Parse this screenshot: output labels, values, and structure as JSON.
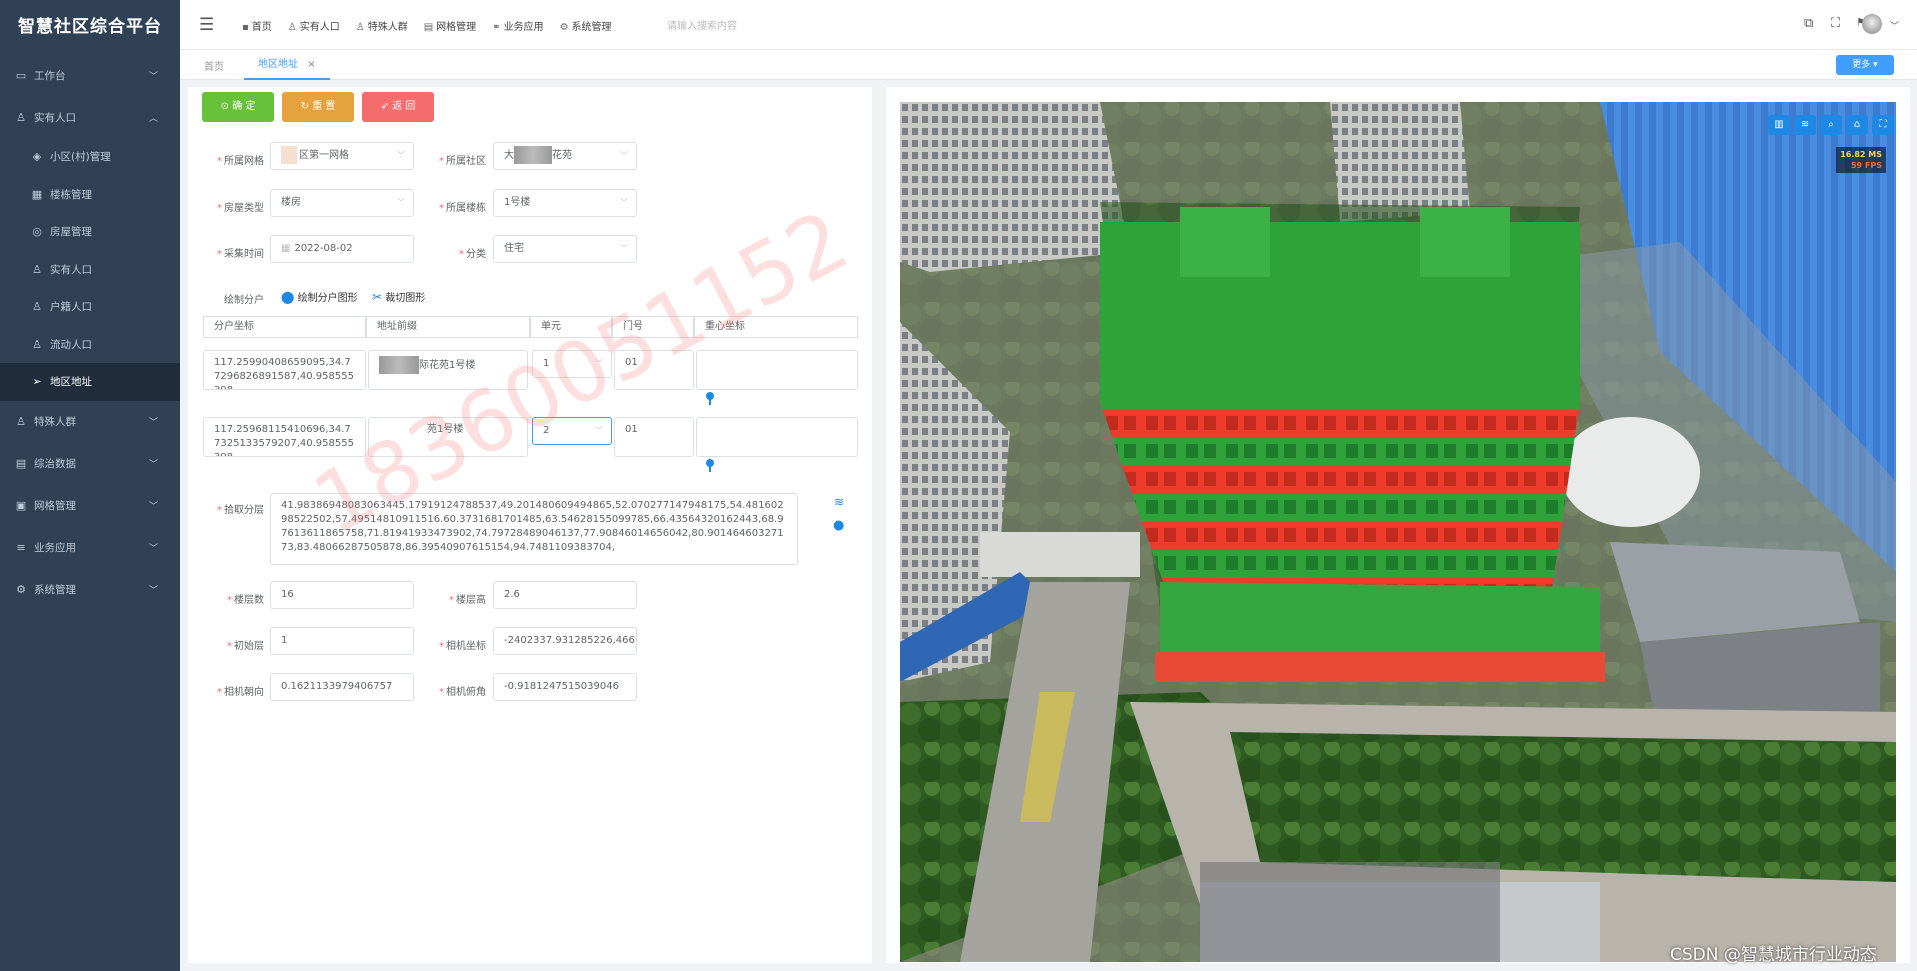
{
  "app": {
    "title": "智慧社区综合平台"
  },
  "sidebar": {
    "menus": [
      {
        "label": "工作台",
        "icon": "monitor-icon",
        "expanded": false
      },
      {
        "label": "实有人口",
        "icon": "user-icon",
        "expanded": true
      }
    ],
    "subitems": [
      {
        "label": "小区(村)管理",
        "icon": "tag-icon"
      },
      {
        "label": "楼栋管理",
        "icon": "building-icon"
      },
      {
        "label": "房屋管理",
        "icon": "location-icon"
      },
      {
        "label": "实有人口",
        "icon": "user-icon"
      },
      {
        "label": "户籍人口",
        "icon": "user-icon"
      },
      {
        "label": "流动人口",
        "icon": "user-icon"
      },
      {
        "label": "地区地址",
        "icon": "send-icon",
        "active": true
      }
    ],
    "menus2": [
      {
        "label": "特殊人群",
        "icon": "user-icon"
      },
      {
        "label": "综治数据",
        "icon": "data-icon"
      },
      {
        "label": "网格管理",
        "icon": "grid-icon"
      },
      {
        "label": "业务应用",
        "icon": "list-icon"
      },
      {
        "label": "系统管理",
        "icon": "gear-icon"
      }
    ]
  },
  "topbar": {
    "nav": [
      {
        "label": "首页",
        "icon": "grid-icon"
      },
      {
        "label": "实有人口",
        "icon": "user-icon"
      },
      {
        "label": "特殊人群",
        "icon": "user-icon"
      },
      {
        "label": "网格管理",
        "icon": "table-icon"
      },
      {
        "label": "业务应用",
        "icon": "link-icon"
      },
      {
        "label": "系统管理",
        "icon": "gear-icon"
      }
    ],
    "search_placeholder": "请输入搜索内容"
  },
  "tabs": {
    "home": "首页",
    "current": "地区地址",
    "close": "×",
    "more": "更多"
  },
  "form": {
    "buttons": {
      "confirm": "确 定",
      "reset": "重 置",
      "back": "返 回"
    },
    "colors": {
      "confirm": "#67c23a",
      "reset": "#e6a23c",
      "back": "#f56c6c"
    },
    "grid": {
      "label": "所属网格",
      "value": "区第一网格"
    },
    "community": {
      "label": "所属社区",
      "value": "大",
      "value2": "花苑"
    },
    "house_type": {
      "label": "房屋类型",
      "value": "楼房"
    },
    "building": {
      "label": "所属楼栋",
      "value": "1号楼"
    },
    "collect_time": {
      "label": "采集时间",
      "value": "2022-08-02"
    },
    "category": {
      "label": "分类",
      "value": "住宅"
    },
    "draw": {
      "label": "绘制分户",
      "draw_shape": "绘制分户图形",
      "cut_shape": "裁切图形"
    },
    "table_headers": [
      "分户坐标",
      "地址前缀",
      "单元",
      "门号",
      "重心坐标"
    ],
    "rows": [
      {
        "coords": "117.25990408659095,34.77296826891587,40.958555398",
        "prefix": "际花苑1号楼",
        "unit": "1",
        "door": "01",
        "center": ""
      },
      {
        "coords": "117.25968115410696,34.77325133579207,40.958555398",
        "prefix": "苑1号楼",
        "unit": "2",
        "door": "01",
        "center": ""
      }
    ],
    "layers": {
      "label": "拾取分层",
      "value": "41.98386948083063445.17919124788537,49.201480609494865,52.07027714794817​5,54.48160298522502,57.4951481091151​6.60.37316817014​85,63.5462815509978​5,66.43564320162443,68.97613611865758,71.81941933473902,74.79728489046137,77.90846014656042,80.90146460327173,83.48066287505878,86.39540907615154,94.7481109383704,"
    },
    "floor_count": {
      "label": "楼层数",
      "value": "16"
    },
    "floor_height": {
      "label": "楼层高",
      "value": "2.6"
    },
    "start_floor": {
      "label": "初始层",
      "value": "1"
    },
    "camera_coord": {
      "label": "相机坐标",
      "value": "-2402337.931285226,466"
    },
    "camera_heading": {
      "label": "相机朝向",
      "value": "0.1621133979406757"
    },
    "camera_pitch": {
      "label": "相机俯角",
      "value": "-0.9181247515039046"
    },
    "watermark": "18360051152"
  },
  "map": {
    "ms": "16.82 MS",
    "fps": "59 FPS",
    "toolbar_icons": [
      "chart-icon",
      "layers-icon",
      "zoom-icon",
      "home-icon",
      "fullscreen-icon"
    ],
    "credit": "CSDN @智慧城市行业动态"
  }
}
